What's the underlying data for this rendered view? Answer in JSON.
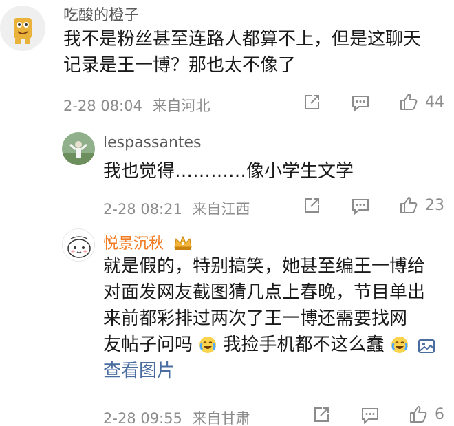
{
  "comments": [
    {
      "username": "吃酸的橙子",
      "lines": [
        "我不是粉丝甚至连路人都算不上，但是这聊天",
        "记录是王一博？那也太不像了"
      ],
      "time": "2-28 08:04",
      "location": "来自河北",
      "likes": "44",
      "avatar_icon": "sponge-cartoon-avatar"
    },
    {
      "username": "lespassantes",
      "lines": [
        "我也觉得…………像小学生文学"
      ],
      "time": "2-28 08:21",
      "location": "来自江西",
      "likes": "23",
      "avatar_icon": "outdoor-photo-avatar"
    },
    {
      "username": "悦景沉秋",
      "badge_icon": "crown-badge-icon",
      "lines": [
        "就是假的，特别搞笑，她甚至编王一博给",
        "对面发网友截图猜几点上春晚，节目单出",
        "来前都彩排过两次了王一博还需要找网",
        "友帖子问吗",
        "我捡手机都不这么蠢"
      ],
      "view_image": "查看图片",
      "time": "2-28 09:55",
      "location": "来自甘肃",
      "likes": "6",
      "avatar_icon": "cartoon-face-avatar"
    }
  ],
  "icons": {
    "share": "share-icon",
    "comment": "comment-icon",
    "like": "thumbs-up-icon",
    "crying_emoji": "crying-laugh-emoji-icon",
    "image": "image-icon"
  },
  "colors": {
    "text": "#1a1a1a",
    "meta": "#8c8c8c",
    "username": "#5a5a5a",
    "vip_username": "#f07b22",
    "link": "#4a6da0"
  }
}
